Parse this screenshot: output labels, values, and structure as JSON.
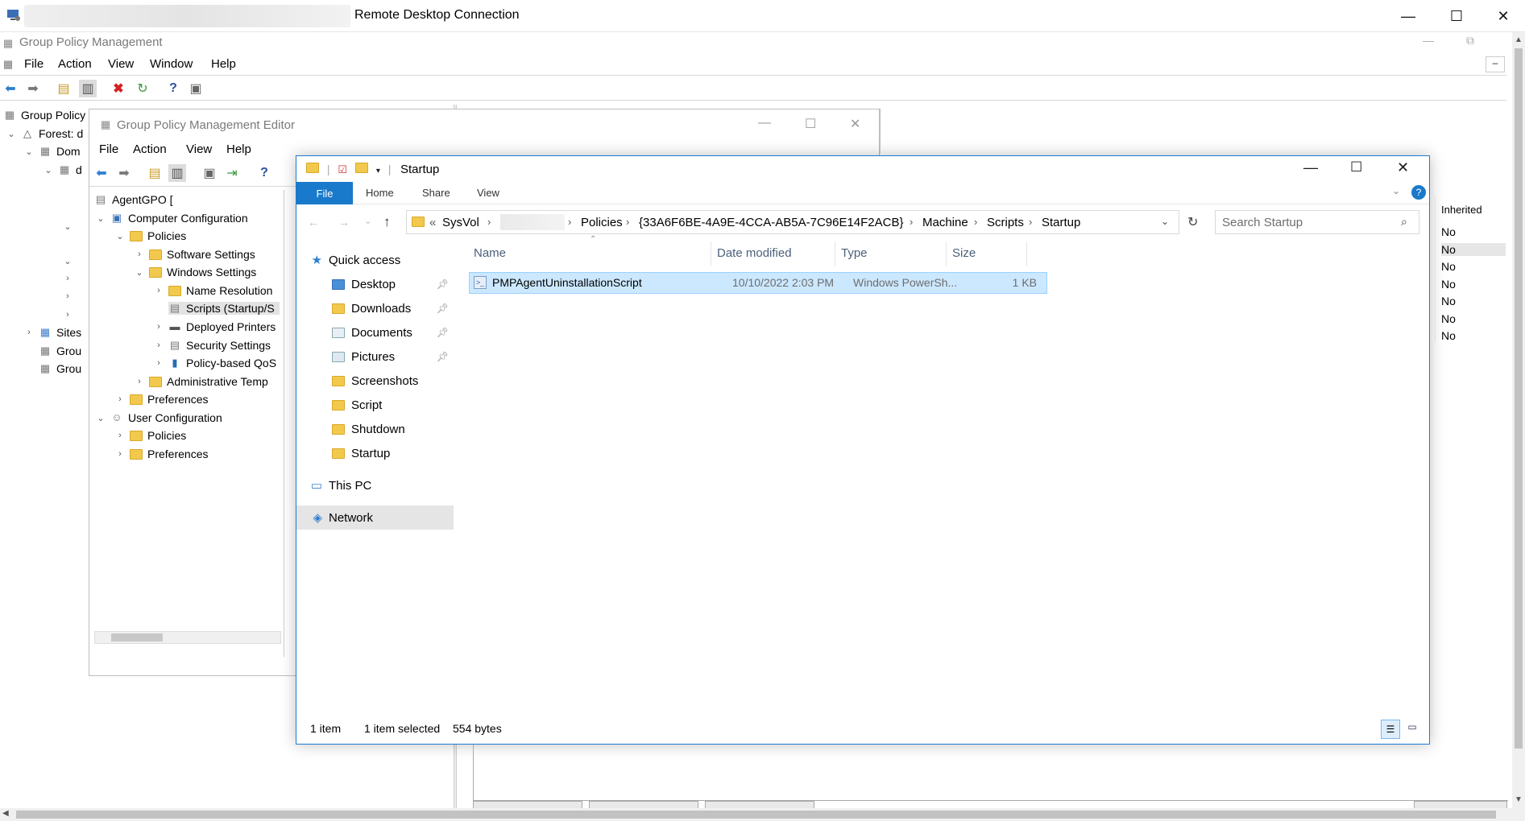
{
  "rdp": {
    "title": "Remote Desktop Connection"
  },
  "gpm": {
    "title": "Group Policy Management",
    "menu": [
      "File",
      "Action",
      "View",
      "Window",
      "Help"
    ],
    "tree": [
      {
        "label": "Group Policy"
      },
      {
        "label": "Forest: d"
      },
      {
        "label": "Dom"
      },
      {
        "label": "d"
      },
      {
        "label": "Sites"
      },
      {
        "label": "Grou"
      },
      {
        "label": "Grou"
      }
    ]
  },
  "gpme": {
    "title": "Group Policy Management Editor",
    "menu": [
      "File",
      "Action",
      "View",
      "Help"
    ],
    "tree": [
      {
        "label": "AgentGPO ["
      },
      {
        "label": "Computer Configuration"
      },
      {
        "label": "Policies"
      },
      {
        "label": "Software Settings"
      },
      {
        "label": "Windows Settings"
      },
      {
        "label": "Name Resolution"
      },
      {
        "label": "Scripts (Startup/S"
      },
      {
        "label": "Deployed Printers"
      },
      {
        "label": "Security Settings"
      },
      {
        "label": "Policy-based QoS"
      },
      {
        "label": "Administrative Temp"
      },
      {
        "label": "Preferences"
      },
      {
        "label": "User Configuration"
      },
      {
        "label": "Policies"
      },
      {
        "label": "Preferences"
      }
    ]
  },
  "explorer": {
    "title": "Startup",
    "ribbon": {
      "file": "File",
      "tabs": [
        "Home",
        "Share",
        "View"
      ]
    },
    "address": {
      "prefix": "«",
      "crumbs": [
        "SysVol",
        "Policies",
        "{33A6F6BE-4A9E-4CCA-AB5A-7C96E14F2ACB}",
        "Machine",
        "Scripts",
        "Startup"
      ]
    },
    "search_placeholder": "Search Startup",
    "nav": {
      "quick_access": "Quick access",
      "items": [
        {
          "label": "Desktop",
          "pinned": true
        },
        {
          "label": "Downloads",
          "pinned": true
        },
        {
          "label": "Documents",
          "pinned": true
        },
        {
          "label": "Pictures",
          "pinned": true
        },
        {
          "label": "Screenshots",
          "pinned": false
        },
        {
          "label": "Script",
          "pinned": false
        },
        {
          "label": "Shutdown",
          "pinned": false
        },
        {
          "label": "Startup",
          "pinned": false
        }
      ],
      "this_pc": "This PC",
      "network": "Network"
    },
    "columns": {
      "name": "Name",
      "date": "Date modified",
      "type": "Type",
      "size": "Size"
    },
    "files": [
      {
        "name": "PMPAgentUninstallationScript",
        "date": "10/10/2022 2:03 PM",
        "type": "Windows PowerSh...",
        "size": "1 KB"
      }
    ],
    "status": {
      "count": "1 item",
      "selected": "1 item selected",
      "bytes": "554 bytes"
    }
  },
  "right_panel": {
    "header": "Inherited",
    "values": [
      "No",
      "No",
      "No",
      "No",
      "No",
      "No",
      "No"
    ]
  },
  "colors": {
    "accent": "#1979ca",
    "selection": "#cce8ff",
    "folder": "#f2c94c"
  }
}
